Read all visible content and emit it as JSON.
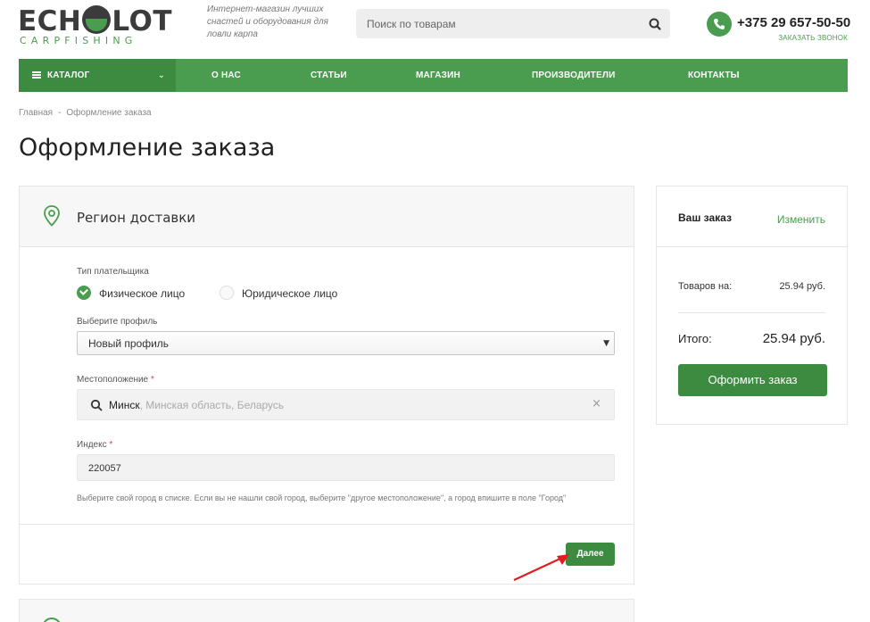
{
  "header": {
    "logo_text_left": "ECH",
    "logo_text_right": "LOT",
    "logo_subtext": "CARPFISHING",
    "tagline": "Интернет-магазин лучших снастей и оборудования для ловли карпа",
    "search_placeholder": "Поиск по товарам",
    "phone": "+375 29 657-50-50",
    "callback": "ЗАКАЗАТЬ ЗВОНОК",
    "accent_color": "#4a9d4e"
  },
  "nav": {
    "catalog": "КАТАЛОГ",
    "items": [
      "О НАС",
      "СТАТЬИ",
      "МАГАЗИН",
      "ПРОИЗВОДИТЕЛИ",
      "КОНТАКТЫ"
    ]
  },
  "breadcrumb": {
    "home": "Главная",
    "separator": "-",
    "current": "Оформление заказа"
  },
  "page_title": "Оформление заказа",
  "region": {
    "title": "Регион доставки",
    "payer_type_label": "Тип плательщика",
    "payer_options": [
      {
        "label": "Физическое лицо",
        "selected": true
      },
      {
        "label": "Юридическое лицо",
        "selected": false
      }
    ],
    "profile_label": "Выберите профиль",
    "profile_value": "Новый профиль",
    "location_label": "Местоположение",
    "required_mark": "*",
    "location_city": "Минск",
    "location_rest": ", Минская область, Беларусь",
    "index_label": "Индекс",
    "index_value": "220057",
    "hint": "Выберите свой город в списке. Если вы не нашли свой город, выберите \"другое местоположение\", а город впишите в поле \"Город\"",
    "next_button": "Далее"
  },
  "summary": {
    "title": "Ваш заказ",
    "edit": "Изменить",
    "goods_label": "Товаров на:",
    "goods_value": "25.94 руб.",
    "total_label": "Итого:",
    "total_value": "25.94 руб.",
    "checkout_button": "Оформить заказ"
  }
}
